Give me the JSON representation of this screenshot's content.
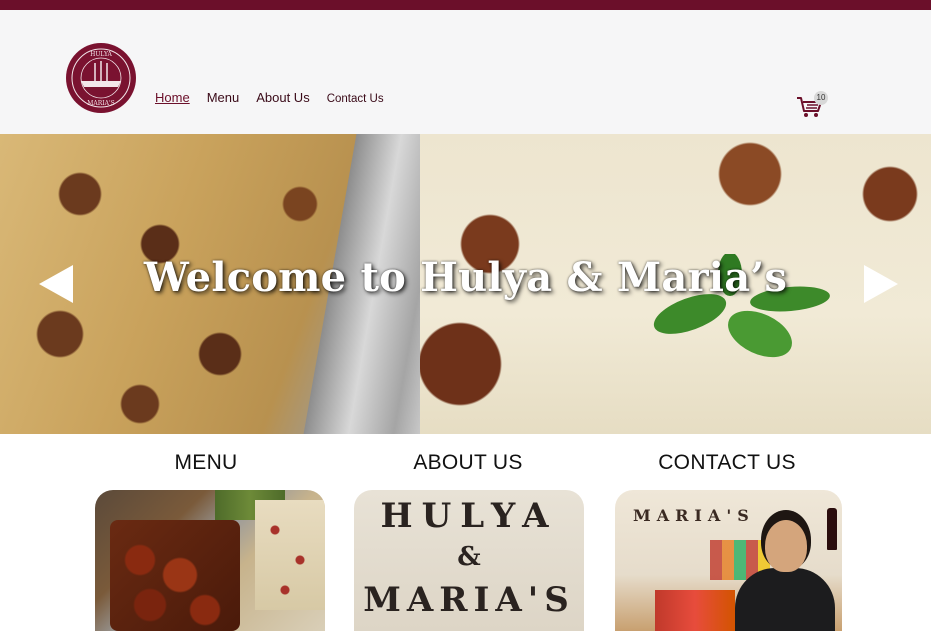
{
  "header": {
    "nav": [
      {
        "label": "Home",
        "active": true
      },
      {
        "label": "Menu",
        "active": false
      },
      {
        "label": "About Us",
        "active": false
      },
      {
        "label": "Contact Us",
        "active": false
      }
    ],
    "cart_count": "10",
    "logo_text": "HULYA & MARIA'S"
  },
  "hero": {
    "title": "Welcome to Hulya & Maria’s"
  },
  "sections": [
    {
      "title": "MENU"
    },
    {
      "title": "ABOUT US",
      "sign_lines": [
        "HULYA",
        "&",
        "MARIA'S"
      ]
    },
    {
      "title": "CONTACT US",
      "sign": "MARIA'S"
    }
  ],
  "colors": {
    "brand": "#6b0f2a",
    "header_bg": "#f6f6f7"
  }
}
